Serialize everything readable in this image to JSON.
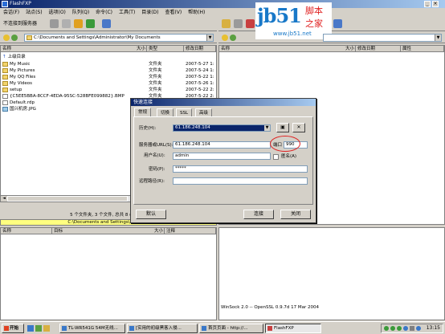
{
  "app": {
    "title": "FlashFXP"
  },
  "menu": [
    "会话(F)",
    "站点(S)",
    "选项(O)",
    "队列(Q)",
    "命令(C)",
    "工具(T)",
    "目录(D)",
    "查看(V)",
    "帮助(H)"
  ],
  "toolbar_left": {
    "unconnected": "不连接到服务器"
  },
  "watermark": {
    "brand": "jb51",
    "cn_top": "脚本",
    "cn_bottom": "之家",
    "url": "www.jb51.net"
  },
  "left_pane": {
    "path": "C:\\Documents and Settings\\Administrator\\My Documents",
    "columns": [
      "名称",
      "大小",
      "类型",
      "修改日期"
    ],
    "parent_label": "上级目录",
    "rows": [
      {
        "name": "My Music",
        "type": "文件夹",
        "date": "2007-5-27 1:"
      },
      {
        "name": "My Pictures",
        "type": "文件夹",
        "date": "2007-5-24 1:"
      },
      {
        "name": "My QQ Files",
        "type": "文件夹",
        "date": "2007-5-22 1:"
      },
      {
        "name": "My Videos",
        "type": "文件夹",
        "date": "2007-5-26 1:"
      },
      {
        "name": "setup",
        "type": "文件夹",
        "date": "2007-5-22 2:"
      },
      {
        "name": "{C5EE5BBA-8CCF-4EDA-95SC-528BFE099882}.BMP",
        "type": "文件夹",
        "date": "2007-5-22 2:"
      },
      {
        "name": "Default.rdp",
        "type": "",
        "date": ""
      },
      {
        "name": "国兴机房.JPG",
        "type": "",
        "date": ""
      }
    ],
    "status1": "5 个文件夹, 3 个文件, 总共 8 (213 KB",
    "status2": "C:\\Documents and Settings\\Administ"
  },
  "right_pane": {
    "columns": [
      "名称",
      "大小",
      "修改日期",
      "属性"
    ]
  },
  "queue": {
    "columns": [
      "名称",
      "目标",
      "大小",
      "注释"
    ]
  },
  "log": {
    "text": "WinSock 2.0 -- OpenSSL 0.9.7d 17 Mar 2004"
  },
  "dialog": {
    "title": "快速连接",
    "tabs": [
      "常规",
      "切换",
      "SSL",
      "高级"
    ],
    "history_label": "历史(H):",
    "history_value": "61.186.248.104",
    "server_label": "服务器或URL(S):",
    "server_value": "61.186.248.104",
    "port_label": "端口",
    "port_value": "990",
    "user_label": "用户名(U):",
    "user_value": "admin",
    "anon_label": "匿名(A)",
    "pass_label": "密码(P):",
    "pass_value": "*****",
    "remote_label": "远程路径(R):",
    "remote_value": "",
    "default_btn": "默认",
    "connect_btn": "连接",
    "close_btn": "关闭"
  },
  "taskbar": {
    "start": "开始",
    "tasks": [
      "TL-WR541G 54M无线...",
      "[实用的初级黑客入侵...",
      "首页页面 - http://...",
      "FlashFXP"
    ],
    "clock": "13:15"
  }
}
